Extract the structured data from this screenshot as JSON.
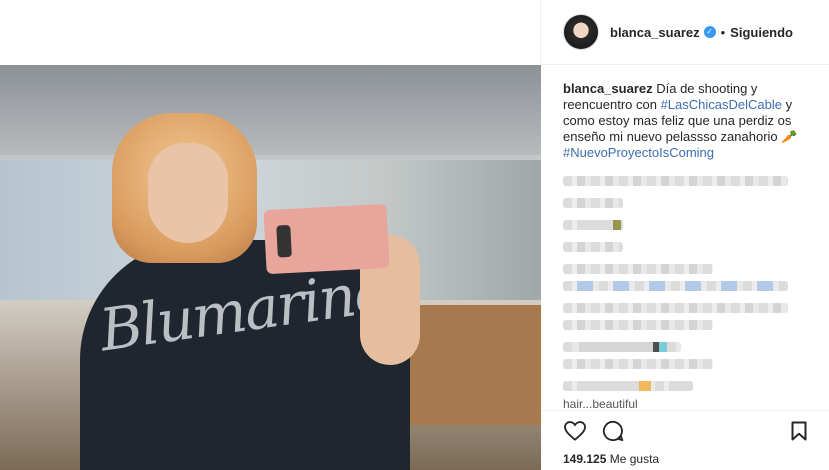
{
  "post": {
    "username": "blanca_suarez",
    "verified_icon": "verified-badge-icon",
    "separator": "•",
    "follow_status": "Siguiendo"
  },
  "caption": {
    "username": "blanca_suarez",
    "text_1": "Día de shooting y reencuentro con",
    "hashtag_1": "#LasChicasDelCable",
    "text_2": "y como estoy mas feliz que una perdiz os enseño mi nuevo pelassso zanahorio",
    "emoji": "🥕",
    "hashtag_2": "#NuevoProyectoIsComing"
  },
  "comments_last_visible": "hair...beautiful",
  "actions": {
    "like_icon": "heart-icon",
    "comment_icon": "comment-icon",
    "save_icon": "bookmark-icon"
  },
  "likes": {
    "count": "149.125",
    "label": "Me gusta"
  },
  "colors": {
    "link": "#3d6db0",
    "verified": "#3897f0",
    "text": "#262626",
    "border": "#efefef"
  }
}
